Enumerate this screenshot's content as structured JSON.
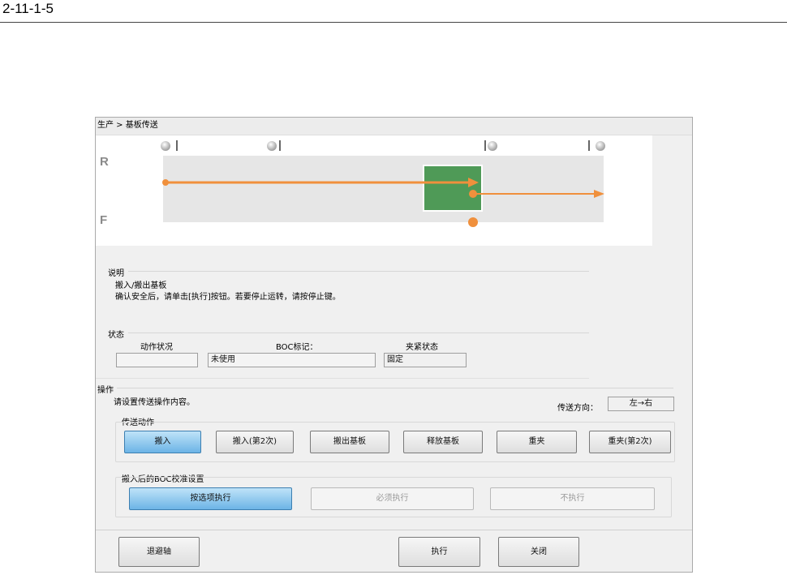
{
  "doc_number": "2-11-1-5",
  "breadcrumb": "生产 > 基板传送",
  "conveyor": {
    "rear_label": "R",
    "front_label": "F",
    "colors": {
      "arrow": "#f0903c",
      "board": "#4f9a57",
      "rail": "#e6e6e6",
      "sensor": "#bdbdbd"
    }
  },
  "description": {
    "label": "说明",
    "line1": "搬入/搬出基板",
    "line2": "确认安全后，请单击[执行]按钮。若要停止运转，请按停止键。"
  },
  "status": {
    "label": "状态",
    "motion_label": "动作状况",
    "motion_value": "",
    "boc_label": "BOC标记：",
    "boc_value": "未使用",
    "clamp_label": "夹紧状态",
    "clamp_value": "固定"
  },
  "operation": {
    "label": "操作",
    "instruction": "请设置传送操作内容。",
    "direction_label": "传送方向：",
    "direction_value": "左→右",
    "transfer_group_label": "传送动作",
    "transfer_buttons": [
      "搬入",
      "搬入(第2次)",
      "搬出基板",
      "释放基板",
      "重夹",
      "重夹(第2次)"
    ],
    "boc_group_label": "搬入后的BOC校准设置",
    "boc_buttons": [
      "按选项执行",
      "必须执行",
      "不执行"
    ]
  },
  "footer": {
    "retract_label": "退避轴",
    "execute_label": "执行",
    "close_label": "关闭"
  }
}
